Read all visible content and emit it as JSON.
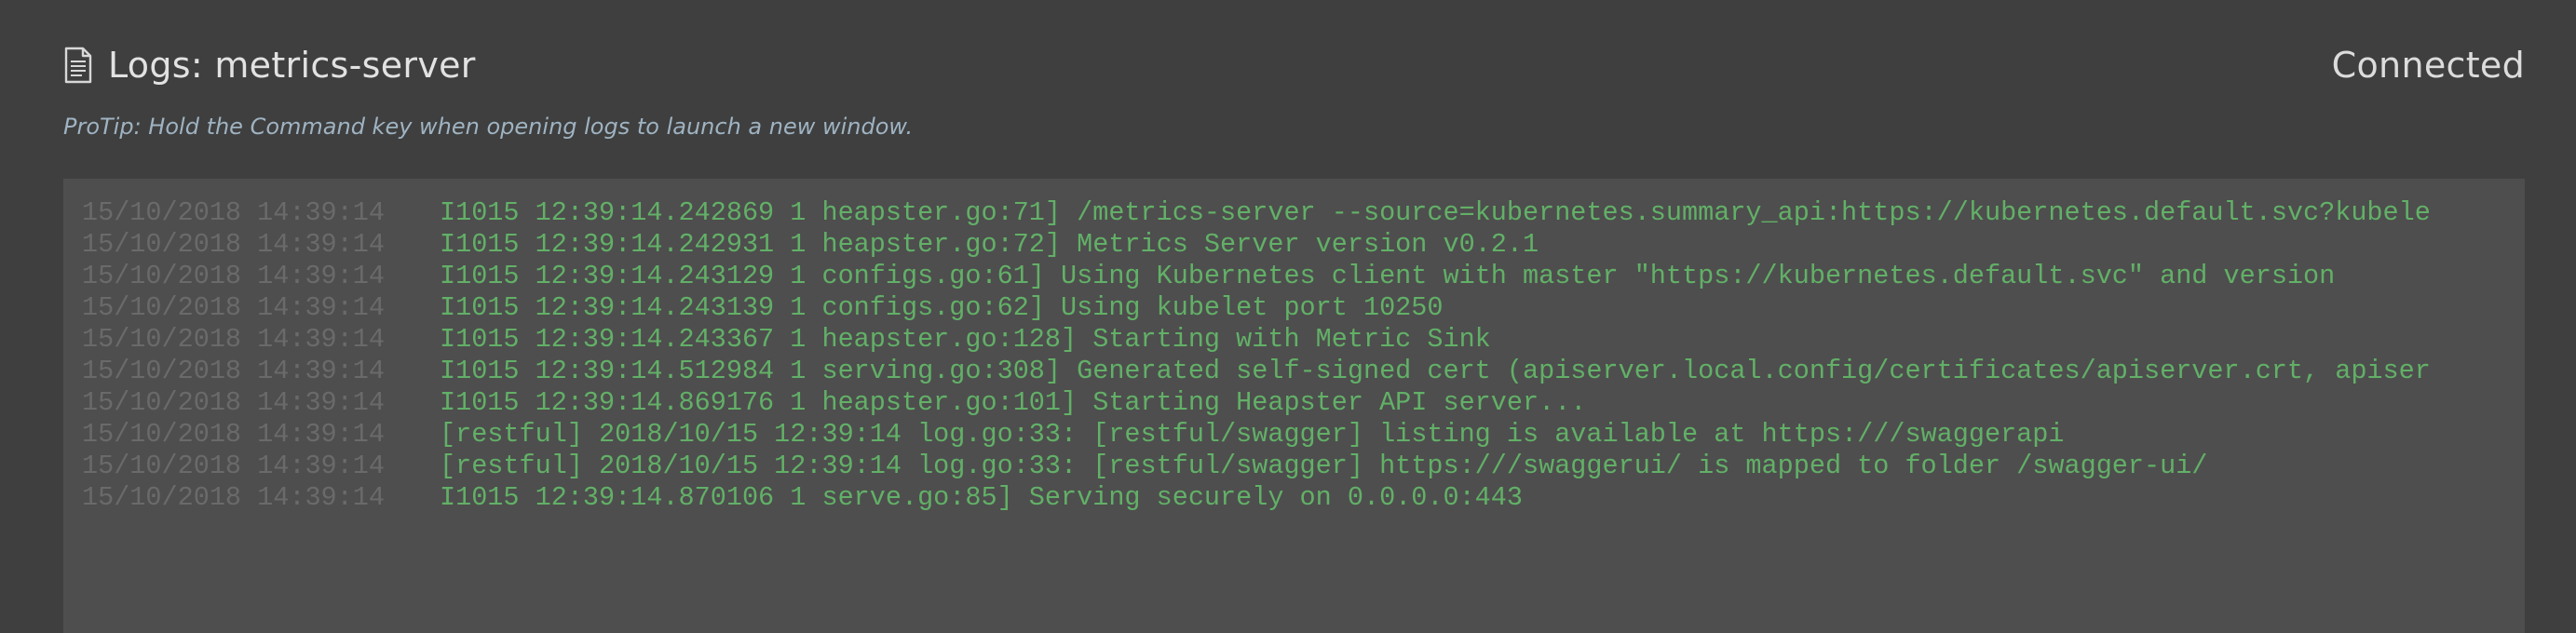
{
  "header": {
    "title": "Logs: metrics-server",
    "status": "Connected",
    "title_icon": "document-icon"
  },
  "protip": "ProTip: Hold the Command key when opening logs to launch a new window.",
  "logs": [
    {
      "ts": "15/10/2018 14:39:14",
      "msg": "I1015 12:39:14.242869 1 heapster.go:71] /metrics-server --source=kubernetes.summary_api:https://kubernetes.default.svc?kubele"
    },
    {
      "ts": "15/10/2018 14:39:14",
      "msg": "I1015 12:39:14.242931 1 heapster.go:72] Metrics Server version v0.2.1"
    },
    {
      "ts": "15/10/2018 14:39:14",
      "msg": "I1015 12:39:14.243129 1 configs.go:61] Using Kubernetes client with master \"https://kubernetes.default.svc\" and version"
    },
    {
      "ts": "15/10/2018 14:39:14",
      "msg": "I1015 12:39:14.243139 1 configs.go:62] Using kubelet port 10250"
    },
    {
      "ts": "15/10/2018 14:39:14",
      "msg": "I1015 12:39:14.243367 1 heapster.go:128] Starting with Metric Sink"
    },
    {
      "ts": "15/10/2018 14:39:14",
      "msg": "I1015 12:39:14.512984 1 serving.go:308] Generated self-signed cert (apiserver.local.config/certificates/apiserver.crt, apiser"
    },
    {
      "ts": "15/10/2018 14:39:14",
      "msg": "I1015 12:39:14.869176 1 heapster.go:101] Starting Heapster API server..."
    },
    {
      "ts": "15/10/2018 14:39:14",
      "msg": "[restful] 2018/10/15 12:39:14 log.go:33: [restful/swagger] listing is available at https:///swaggerapi"
    },
    {
      "ts": "15/10/2018 14:39:14",
      "msg": "[restful] 2018/10/15 12:39:14 log.go:33: [restful/swagger] https:///swaggerui/ is mapped to folder /swagger-ui/"
    },
    {
      "ts": "15/10/2018 14:39:14",
      "msg": "I1015 12:39:14.870106 1 serve.go:85] Serving securely on 0.0.0.0:443"
    }
  ],
  "colors": {
    "background": "#3f3f3f",
    "panel": "#4e4e4e",
    "log_text": "#62b067",
    "timestamp": "#6a6a6a",
    "protip": "#9fb3c2"
  }
}
